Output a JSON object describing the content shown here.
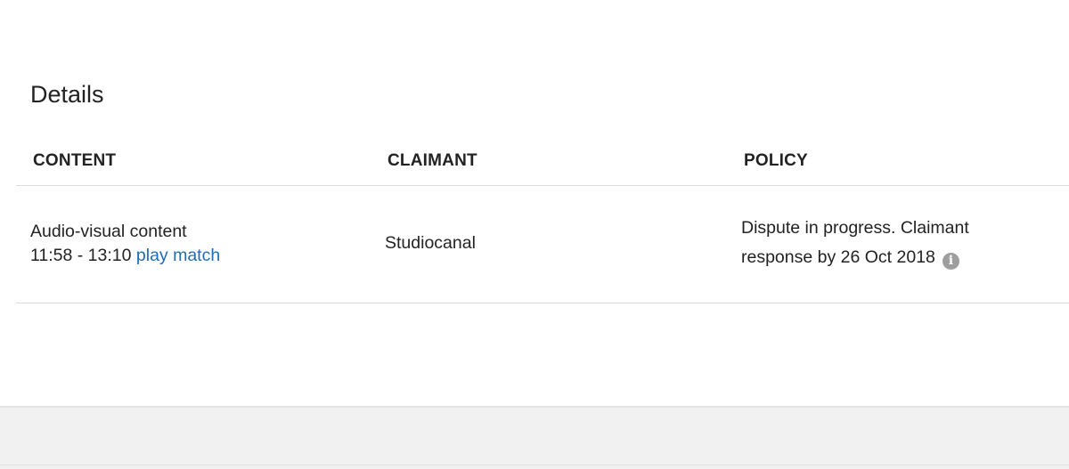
{
  "details": {
    "title": "Details",
    "columns": {
      "content": "CONTENT",
      "claimant": "CLAIMANT",
      "policy": "POLICY"
    },
    "rows": [
      {
        "content_type": "Audio-visual content",
        "time_range": "11:58 - 13:10",
        "play_match_label": "play match",
        "claimant": "Studiocanal",
        "policy_line1": "Dispute in progress. Claimant",
        "policy_line2": "response by 26 Oct 2018",
        "info_icon": "info-icon",
        "info_icon_glyph": "i"
      }
    ]
  },
  "colors": {
    "link": "#1f6bb8",
    "icon_gray": "#9e9e9e",
    "footer_bg": "#f1f1f1"
  }
}
